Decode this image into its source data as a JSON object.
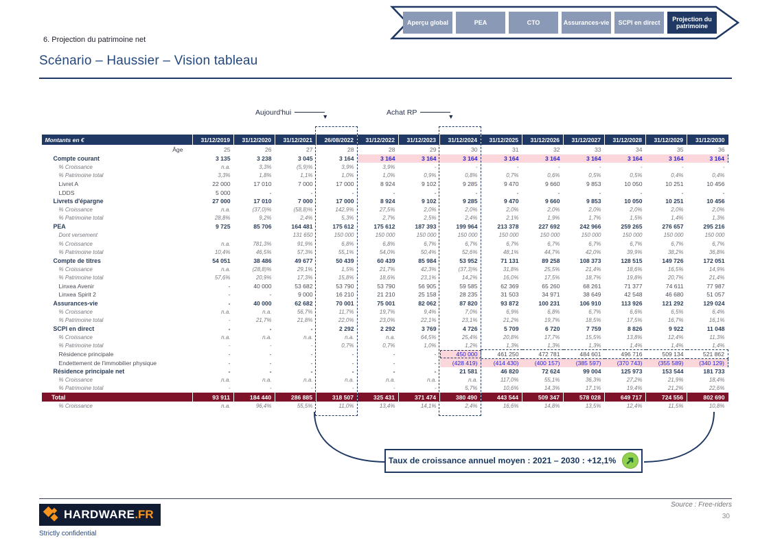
{
  "banner": {
    "tabs": [
      {
        "label": "Aperçu global",
        "active": false
      },
      {
        "label": "PEA",
        "active": false
      },
      {
        "label": "CTO",
        "active": false
      },
      {
        "label": "Assurances-vie",
        "active": false
      },
      {
        "label": "SCPI en direct",
        "active": false
      },
      {
        "label": "Projection du patrimoine",
        "active": true
      }
    ]
  },
  "breadcrumb": "6. Projection du patrimoine net",
  "title": "Scénario – Haussier – Vision tableau",
  "annotations": {
    "today": "Aujourd'hui",
    "achat_rp": "Achat RP"
  },
  "table": {
    "corner_label": "Montants en €",
    "age_label": "Âge",
    "columns": [
      "31/12/2019",
      "31/12/2020",
      "31/12/2021",
      "26/08/2022",
      "31/12/2022",
      "31/12/2023",
      "31/12/2024",
      "31/12/2025",
      "31/12/2026",
      "31/12/2027",
      "31/12/2028",
      "31/12/2029",
      "31/12/2030"
    ],
    "ages": [
      "25",
      "26",
      "27",
      "28",
      "28",
      "29",
      "30",
      "31",
      "32",
      "33",
      "34",
      "35",
      "36"
    ],
    "rows": [
      {
        "label": "Compte courant",
        "style": "bold",
        "pink_from": 4,
        "values": [
          "3 135",
          "3 238",
          "3 045",
          "3 164",
          "3 164",
          "3 164",
          "3 164",
          "3 164",
          "3 164",
          "3 164",
          "3 164",
          "3 164",
          "3 164"
        ]
      },
      {
        "label": "% Croissance",
        "style": "pct",
        "values": [
          "n.a.",
          "3,3%",
          "(5,9)%",
          "3,9%",
          "3,9%",
          "-",
          "-",
          "-",
          "-",
          "-",
          "-",
          "-",
          "-"
        ]
      },
      {
        "label": "% Patrimoine total",
        "style": "pct",
        "values": [
          "3,3%",
          "1,8%",
          "1,1%",
          "1,0%",
          "1,0%",
          "0,9%",
          "0,8%",
          "0,7%",
          "0,6%",
          "0,5%",
          "0,5%",
          "0,4%",
          "0,4%"
        ]
      },
      {
        "label": "Livret A",
        "style": "item",
        "values": [
          "22 000",
          "17 010",
          "7 000",
          "17 000",
          "8 924",
          "9 102",
          "9 285",
          "9 470",
          "9 660",
          "9 853",
          "10 050",
          "10 251",
          "10 456"
        ]
      },
      {
        "label": "LDDS",
        "style": "item",
        "values": [
          "5 000",
          "-",
          "-",
          "-",
          "-",
          "-",
          "-",
          "-",
          "-",
          "-",
          "-",
          "-",
          "-"
        ]
      },
      {
        "label": "Livrets d'épargne",
        "style": "bold",
        "values": [
          "27 000",
          "17 010",
          "7 000",
          "17 000",
          "8 924",
          "9 102",
          "9 285",
          "9 470",
          "9 660",
          "9 853",
          "10 050",
          "10 251",
          "10 456"
        ]
      },
      {
        "label": "% Croissance",
        "style": "pct",
        "values": [
          "n.a.",
          "(37,0)%",
          "(58,8)%",
          "142,9%",
          "27,5%",
          "2,0%",
          "2,0%",
          "2,0%",
          "2,0%",
          "2,0%",
          "2,0%",
          "2,0%",
          "2,0%"
        ]
      },
      {
        "label": "% Patrimoine total",
        "style": "pct",
        "values": [
          "28,8%",
          "9,2%",
          "2,4%",
          "5,3%",
          "2,7%",
          "2,5%",
          "2,4%",
          "2,1%",
          "1,9%",
          "1,7%",
          "1,5%",
          "1,4%",
          "1,3%"
        ]
      },
      {
        "label": "PEA",
        "style": "bold",
        "values": [
          "9 725",
          "85 706",
          "164 481",
          "175 612",
          "175 612",
          "187 393",
          "199 964",
          "213 378",
          "227 692",
          "242 966",
          "259 265",
          "276 657",
          "295 216"
        ]
      },
      {
        "label": "Dont versement",
        "style": "pct",
        "values": [
          "",
          "",
          "131 650",
          "150 000",
          "150 000",
          "150 000",
          "150 000",
          "150 000",
          "150 000",
          "150 000",
          "150 000",
          "150 000",
          "150 000"
        ]
      },
      {
        "label": "% Croissance",
        "style": "pct",
        "values": [
          "n.a.",
          "781,3%",
          "91,9%",
          "6,8%",
          "6,8%",
          "6,7%",
          "6,7%",
          "6,7%",
          "6,7%",
          "6,7%",
          "6,7%",
          "6,7%",
          "6,7%"
        ]
      },
      {
        "label": "% Patrimoine total",
        "style": "pct",
        "values": [
          "10,4%",
          "46,5%",
          "57,3%",
          "55,1%",
          "54,0%",
          "50,4%",
          "52,6%",
          "48,1%",
          "44,7%",
          "42,0%",
          "39,9%",
          "38,2%",
          "36,8%"
        ]
      },
      {
        "label": "Compte de titres",
        "style": "bold",
        "values": [
          "54 051",
          "38 486",
          "49 677",
          "50 439",
          "60 439",
          "85 984",
          "53 952",
          "71 131",
          "89 258",
          "108 373",
          "128 515",
          "149 726",
          "172 051"
        ]
      },
      {
        "label": "% Croissance",
        "style": "pct",
        "values": [
          "n.a.",
          "(28,8)%",
          "29,1%",
          "1,5%",
          "21,7%",
          "42,3%",
          "(37,3)%",
          "31,8%",
          "25,5%",
          "21,4%",
          "18,6%",
          "16,5%",
          "14,9%"
        ]
      },
      {
        "label": "% Patrimoine total",
        "style": "pct",
        "values": [
          "57,6%",
          "20,9%",
          "17,3%",
          "15,8%",
          "18,6%",
          "23,1%",
          "14,2%",
          "16,0%",
          "17,5%",
          "18,7%",
          "19,8%",
          "20,7%",
          "21,4%"
        ]
      },
      {
        "label": "Linxea Avenir",
        "style": "item",
        "values": [
          "-",
          "40 000",
          "53 682",
          "53 790",
          "53 790",
          "56 905",
          "59 585",
          "62 369",
          "65 260",
          "68 261",
          "71 377",
          "74 611",
          "77 987"
        ]
      },
      {
        "label": "Linxea Spirit 2",
        "style": "item",
        "values": [
          "-",
          "-",
          "9 000",
          "16 210",
          "21 210",
          "25 158",
          "28 235",
          "31 503",
          "34 971",
          "38 649",
          "42 548",
          "46 680",
          "51 057"
        ]
      },
      {
        "label": "Assurances-vie",
        "style": "bold",
        "values": [
          "-",
          "40 000",
          "62 682",
          "70 001",
          "75 001",
          "82 062",
          "87 820",
          "93 872",
          "100 231",
          "106 910",
          "113 926",
          "121 292",
          "129 024"
        ]
      },
      {
        "label": "% Croissance",
        "style": "pct",
        "values": [
          "n.a.",
          "n.a.",
          "56,7%",
          "11,7%",
          "19,7%",
          "9,4%",
          "7,0%",
          "6,9%",
          "6,8%",
          "6,7%",
          "6,6%",
          "6,5%",
          "6,4%"
        ]
      },
      {
        "label": "% Patrimoine total",
        "style": "pct",
        "values": [
          "-",
          "21,7%",
          "21,8%",
          "22,0%",
          "23,0%",
          "22,1%",
          "23,1%",
          "21,2%",
          "19,7%",
          "18,5%",
          "17,5%",
          "16,7%",
          "16,1%"
        ]
      },
      {
        "label": "SCPI en direct",
        "style": "bold",
        "values": [
          "-",
          "-",
          "-",
          "2 292",
          "2 292",
          "3 769",
          "4 726",
          "5 709",
          "6 720",
          "7 759",
          "8 826",
          "9 922",
          "11 048"
        ]
      },
      {
        "label": "% Croissance",
        "style": "pct",
        "values": [
          "n.a.",
          "n.a.",
          "n.a.",
          "n.a.",
          "n.a.",
          "64,5%",
          "25,4%",
          "20,8%",
          "17,7%",
          "15,5%",
          "13,8%",
          "12,4%",
          "11,3%"
        ]
      },
      {
        "label": "% Patrimoine total",
        "style": "pct",
        "values": [
          "-",
          "-",
          "-",
          "0,7%",
          "0,7%",
          "1,0%",
          "1,2%",
          "1,3%",
          "1,3%",
          "1,3%",
          "1,4%",
          "1,4%",
          "1,4%"
        ]
      },
      {
        "label": "Résidence principale",
        "style": "item",
        "special": "rp",
        "values": [
          "-",
          "-",
          "-",
          "-",
          "-",
          "-",
          "450 000",
          "461 250",
          "472 781",
          "484 601",
          "496 716",
          "509 134",
          "521 862"
        ]
      },
      {
        "label": "Endettement de l'immobilier physique",
        "style": "item",
        "pink_from": 6,
        "values": [
          "-",
          "-",
          "-",
          "-",
          "-",
          "-",
          "(428 419)",
          "(414 430)",
          "(400 157)",
          "(385 597)",
          "(370 743)",
          "(355 589)",
          "(340 129)"
        ]
      },
      {
        "label": "Résidence principale net",
        "style": "bold",
        "values": [
          "-",
          "-",
          "-",
          "-",
          "-",
          "-",
          "21 581",
          "46 820",
          "72 624",
          "99 004",
          "125 973",
          "153 544",
          "181 733"
        ]
      },
      {
        "label": "% Croissance",
        "style": "pct",
        "values": [
          "n.a.",
          "n.a.",
          "n.a.",
          "n.a.",
          "n.a.",
          "n.a.",
          "n.a.",
          "117,0%",
          "55,1%",
          "36,3%",
          "27,2%",
          "21,9%",
          "18,4%"
        ]
      },
      {
        "label": "% Patrimoine total",
        "style": "pct",
        "values": [
          "-",
          "-",
          "-",
          "-",
          "-",
          "-",
          "5,7%",
          "10,6%",
          "14,3%",
          "17,1%",
          "19,4%",
          "21,2%",
          "22,6%"
        ]
      },
      {
        "label": "Total",
        "style": "total",
        "values": [
          "93 911",
          "184 440",
          "286 885",
          "318 507",
          "325 431",
          "371 474",
          "380 490",
          "443 544",
          "509 347",
          "578 028",
          "649 717",
          "724 556",
          "802 690"
        ]
      },
      {
        "label": "% Croissance",
        "style": "pct",
        "values": [
          "n.a.",
          "96,4%",
          "55,5%",
          "11,0%",
          "13,4%",
          "14,1%",
          "2,4%",
          "16,6%",
          "14,8%",
          "13,5%",
          "12,4%",
          "11,5%",
          "10,8%"
        ]
      }
    ]
  },
  "growth_note": {
    "text": "Taux de croissance annuel moyen : 2021 – 2030 : +12,1%",
    "icon": "green-up-arrow"
  },
  "footer": {
    "logo_text": "HARDWARE",
    "logo_suffix": ".FR",
    "confidential": "Strictly confidential",
    "source": "Source : Free-riders",
    "page_number": "30"
  },
  "colors": {
    "navy": "#1F3864",
    "tab_gray": "#8A99B5",
    "total_maroon": "#7D1228",
    "highlight_pink": "#FBD7DB",
    "highlight_blue": "#2222DD",
    "growth_green": "#92D050",
    "logo_orange": "#F7941E"
  }
}
